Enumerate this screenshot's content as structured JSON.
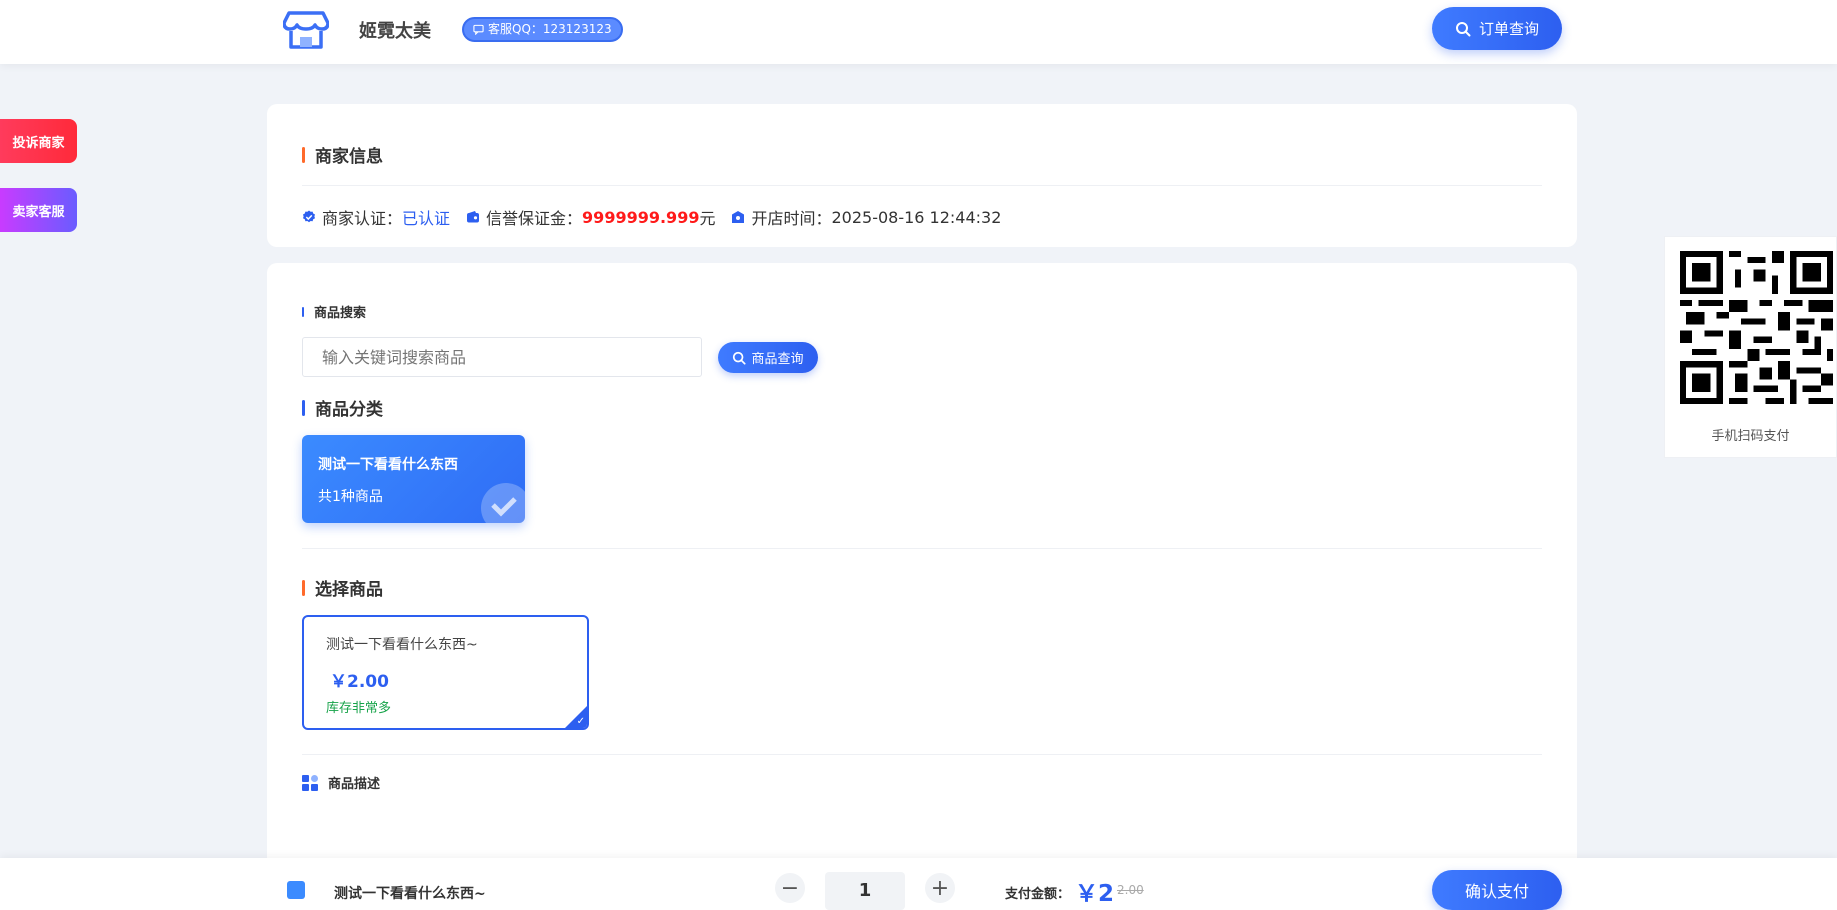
{
  "header": {
    "shop_name": "姬霓太美",
    "qq_badge": "客服QQ：123123123",
    "order_query": "订单查询"
  },
  "side": {
    "complain": "投诉商家",
    "seller_service": "卖家客服"
  },
  "merchant": {
    "title": "商家信息",
    "cert_label": "商家认证：",
    "cert_value": "已认证",
    "deposit_label": "信誉保证金：",
    "deposit_value": "9999999.999",
    "deposit_unit": "元",
    "open_label": "开店时间：",
    "open_value": "2025-08-16 12:44:32"
  },
  "search": {
    "title": "商品搜索",
    "placeholder": "输入关键词搜索商品",
    "button": "商品查询"
  },
  "category": {
    "title": "商品分类",
    "items": [
      {
        "name": "测试一下看看什么东西",
        "count": "共1种商品"
      }
    ]
  },
  "products": {
    "title": "选择商品",
    "items": [
      {
        "name": "测试一下看看什么东西~",
        "price": "￥2.00",
        "stock": "库存非常多"
      }
    ]
  },
  "description": {
    "title": "商品描述"
  },
  "qr": {
    "caption": "手机扫码支付"
  },
  "footer": {
    "product_name": "测试一下看看什么东西~",
    "quantity": "1",
    "pay_label": "支付金额：",
    "pay_amount": "￥2",
    "original_price": "2.00",
    "confirm": "确认支付"
  },
  "colors": {
    "primary": "#2d5ff0",
    "accent_orange": "#ff6a2b",
    "danger": "#ff1a1a",
    "success": "#17a34a"
  }
}
